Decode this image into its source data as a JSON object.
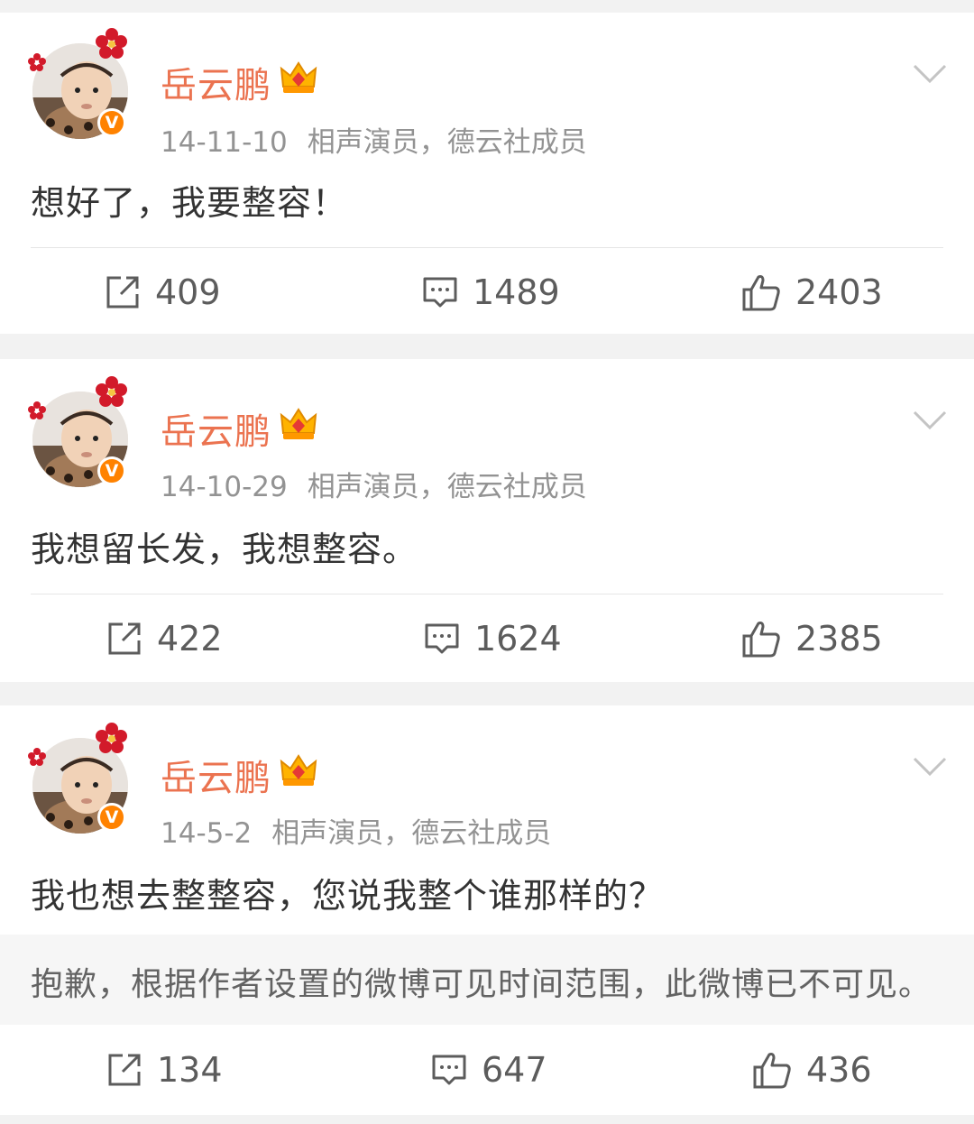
{
  "posts": [
    {
      "author": "岳云鹏",
      "verified_badge": "V",
      "date": "14-11-10",
      "source": "相声演员，德云社成员",
      "text": "想好了，我要整容！",
      "reposts": "409",
      "comments": "1489",
      "likes": "2403"
    },
    {
      "author": "岳云鹏",
      "verified_badge": "V",
      "date": "14-10-29",
      "source": "相声演员，德云社成员",
      "text": "我想留长发，我想整容。",
      "reposts": "422",
      "comments": "1624",
      "likes": "2385"
    },
    {
      "author": "岳云鹏",
      "verified_badge": "V",
      "date": "14-5-2",
      "source": "相声演员，德云社成员",
      "text": "我也想去整整容，您说我整个谁那样的？",
      "notice": "抱歉，根据作者设置的微博可见时间范围，此微博已不可见。",
      "reposts": "134",
      "comments": "647",
      "likes": "436"
    }
  ],
  "colors": {
    "name": "#eb7350",
    "badge": "#ff8200",
    "meta": "#939393",
    "body_text": "#333333",
    "separator": "#f2f2f2"
  },
  "icons": [
    "repost-icon",
    "comment-icon",
    "like-icon",
    "chevron-down-icon",
    "crown-icon",
    "verified-icon",
    "avatar"
  ]
}
